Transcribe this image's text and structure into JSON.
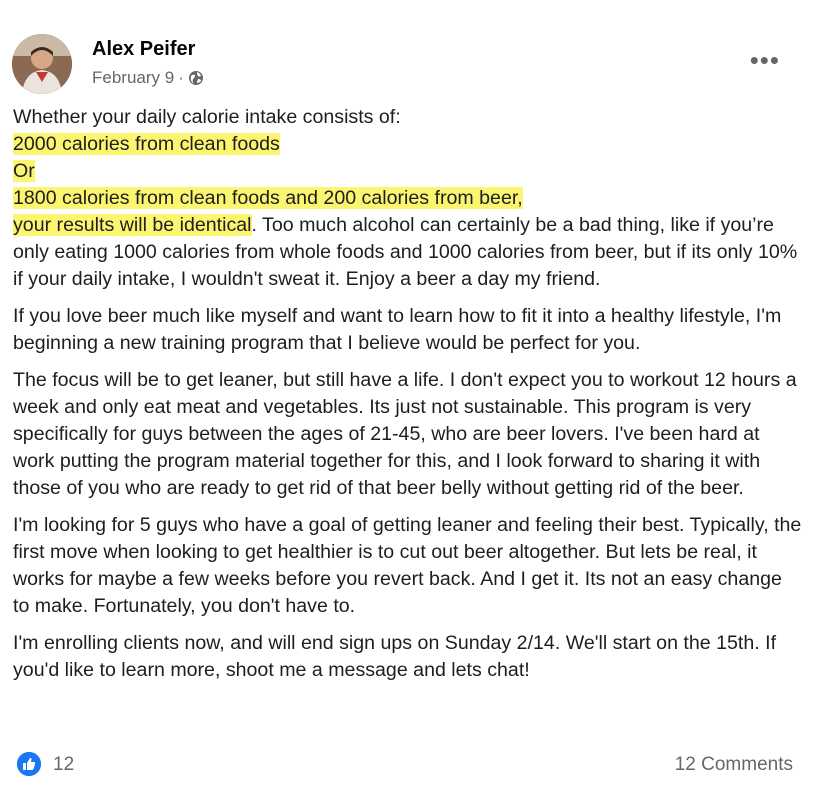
{
  "post": {
    "author": "Alex Peifer",
    "date": "February 9",
    "separator": "·",
    "more_label": "•••",
    "intro": "Whether your daily calorie intake consists of:",
    "highlight_1": "2000 calories from clean foods",
    "highlight_2": "Or",
    "highlight_3": "1800 calories from clean foods and 200 calories from beer,",
    "highlight_4": "your results will be identical",
    "after_highlight": ". Too much alcohol can certainly be a bad thing, like if you’re only eating 1000 calories from whole foods and 1000 calories from beer, but if its only 10% if your daily intake, I wouldn't sweat it. Enjoy a beer a day my friend.",
    "paragraph_2": "If you love beer much like myself and want to learn how to fit it into a healthy lifestyle, I'm beginning a new training program that I believe would be perfect for you.",
    "paragraph_3": "The focus will be to get leaner, but still have a life. I don't expect you to workout 12 hours a week and only eat meat and vegetables. Its just not sustainable. This program is very specifically for guys between the ages of 21-45, who are beer lovers. I've been hard at work putting the program material together for this, and I look forward to sharing it with those of you who are ready to get rid of that beer belly without getting rid of the beer.",
    "paragraph_4": "I'm looking for 5 guys who have a goal of getting leaner and feeling their best. Typically, the first move when looking to get healthier is to cut out beer altogether. But lets be real, it works for maybe a few weeks before you revert back. And I get it. Its not an easy change to make. Fortunately, you don't have to.",
    "paragraph_5": "I'm enrolling clients now, and will end sign ups on Sunday 2/14. We'll start on the 15th. If you'd like to learn more, shoot me a message and lets chat!"
  },
  "footer": {
    "like_count": "12",
    "comments_label": "12 Comments"
  },
  "icons": {
    "privacy": "globe-icon",
    "reaction": "thumbs-up-icon",
    "menu": "more-options-icon"
  },
  "colors": {
    "highlight": "#fbf56f",
    "like_blue": "#1877f2",
    "meta_gray": "#65676b"
  }
}
